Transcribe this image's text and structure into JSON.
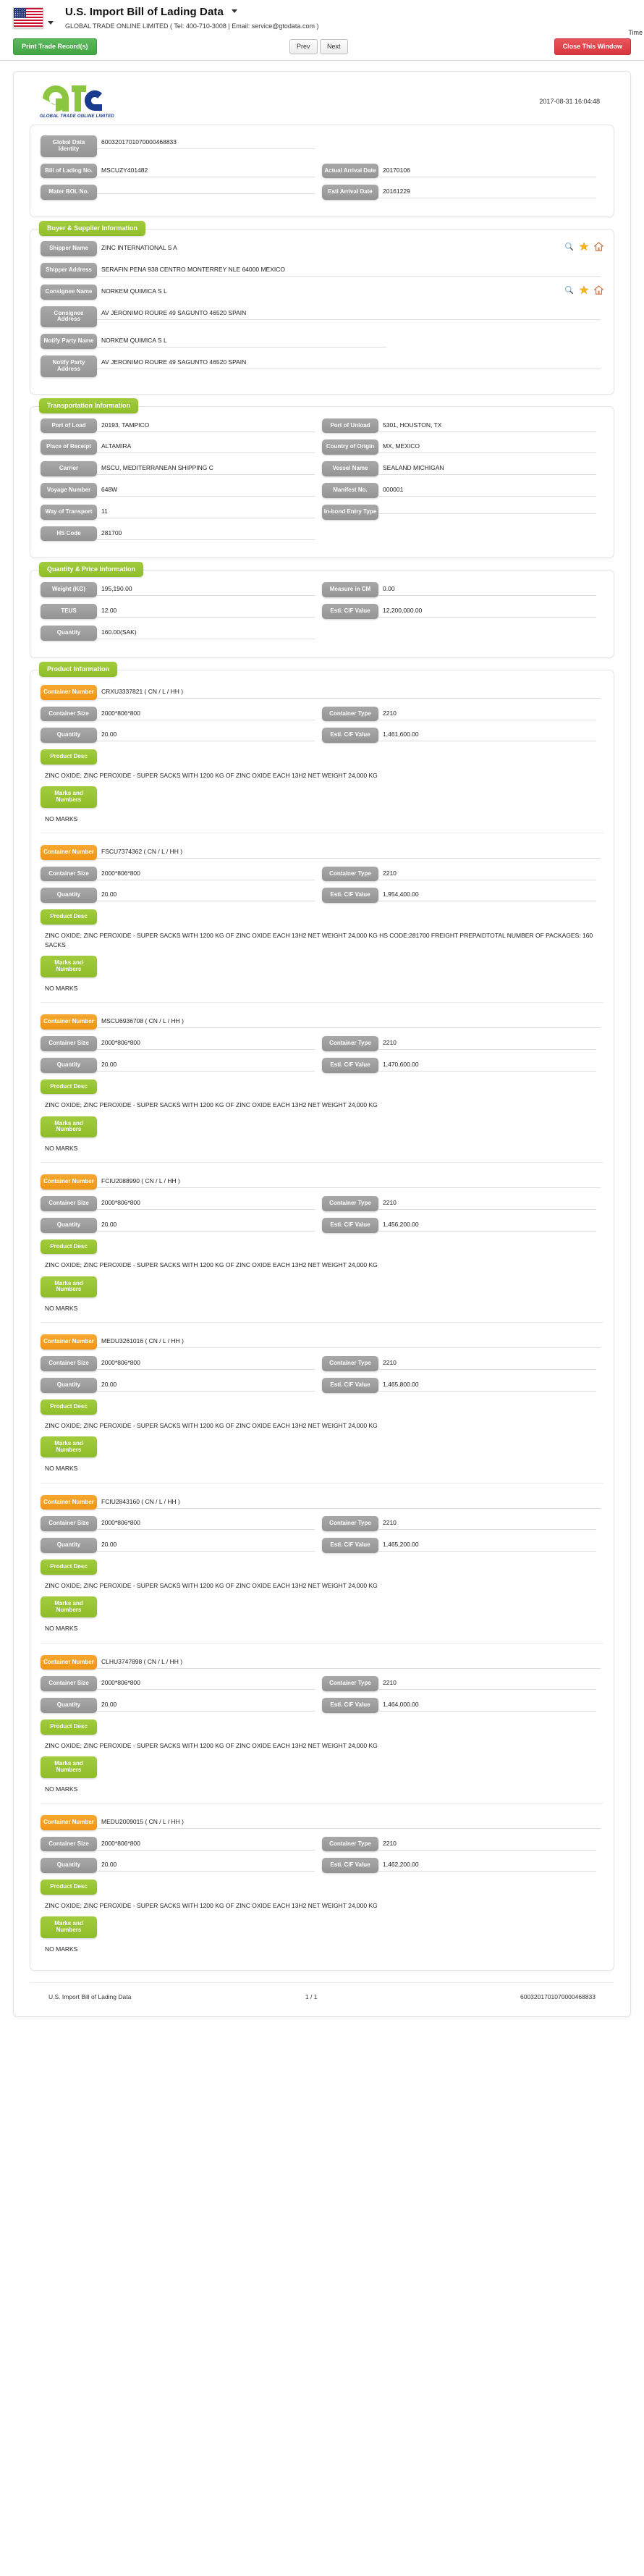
{
  "header": {
    "flag_icon": "us-flag-icon",
    "title": "U.S. Import Bill of Lading Data",
    "subtitle": "GLOBAL TRADE ONLINE LIMITED ( Tel: 400-710-3008  |  Email: service@gtodata.com )",
    "time_label": "Time"
  },
  "toolbar": {
    "print_label": "Print Trade Record(s)",
    "prev_label": "Prev",
    "next_label": "Next",
    "close_label": "Close This Window"
  },
  "document": {
    "logo_caption": "GLOBAL TRADE  ONLINE LIMITED",
    "timestamp": "2017-08-31 16:04:48"
  },
  "identity": {
    "fields": [
      {
        "label": "Global Data Identity",
        "value": "6003201701070000468833"
      },
      {
        "label": "Bill of Lading No.",
        "value": "MSCUZY401482"
      },
      {
        "label": "Actual Arrival Date",
        "value": "20170106"
      },
      {
        "label": "Mater BOL No.",
        "value": ""
      },
      {
        "label": "Esti Arrival Date",
        "value": "20161229"
      }
    ]
  },
  "buyer_supplier": {
    "legend": "Buyer & Supplier Information",
    "fields": [
      {
        "label": "Shipper Name",
        "value": "ZINC INTERNATIONAL S A"
      },
      {
        "label": "Shipper Address",
        "value": "SERAFIN PENA 938 CENTRO MONTERREY NLE 64000 MEXICO"
      },
      {
        "label": "Consignee Name",
        "value": "NORKEM QUIMICA S L"
      },
      {
        "label": "Consignee Address",
        "value": "AV JERONIMO ROURE 49 SAGUNTO 46520 SPAIN"
      },
      {
        "label": "Notify Party Name",
        "value": "NORKEM QUIMICA S L"
      },
      {
        "label": "Notify Party Address",
        "value": "AV JERONIMO ROURE 49 SAGUNTO 46520 SPAIN"
      }
    ],
    "row_icons": [
      "search-icon",
      "star-icon",
      "home-icon"
    ]
  },
  "transportation": {
    "legend": "Transportation Information",
    "fields": [
      {
        "label": "Port of Load",
        "value": "20193, TAMPICO"
      },
      {
        "label": "Port of Unload",
        "value": "5301, HOUSTON, TX"
      },
      {
        "label": "Place of Receipt",
        "value": "ALTAMIRA"
      },
      {
        "label": "Country of Origin",
        "value": "MX, MEXICO"
      },
      {
        "label": "Carrier",
        "value": "MSCU, MEDITERRANEAN SHIPPING C"
      },
      {
        "label": "Vessel Name",
        "value": "SEALAND MICHIGAN"
      },
      {
        "label": "Voyage Number",
        "value": "648W"
      },
      {
        "label": "Manifest No.",
        "value": "000001"
      },
      {
        "label": "Way of Transport",
        "value": "11"
      },
      {
        "label": "In-bond Entry Type",
        "value": ""
      },
      {
        "label": "HS Code",
        "value": "281700"
      }
    ]
  },
  "quantity_price": {
    "legend": "Quantity & Price Information",
    "fields": [
      {
        "label": "Weight (KG)",
        "value": "195,190.00"
      },
      {
        "label": "Measure in CM",
        "value": "0.00"
      },
      {
        "label": "TEUS",
        "value": "12.00"
      },
      {
        "label": "Esti. CIF Value",
        "value": "12,200,000.00"
      },
      {
        "label": "Quantity",
        "value": "160.00(SAK)"
      }
    ]
  },
  "product_information": {
    "legend": "Product Information",
    "labels": {
      "container_number": "Container Number",
      "container_size": "Container Size",
      "container_type": "Container Type",
      "quantity": "Quantity",
      "cif_value": "Esti. CIF Value",
      "product_desc": "Product Desc",
      "marks_and_numbers": "Marks and Numbers"
    },
    "containers": [
      {
        "number": "CRXU3337821 ( CN / L / HH )",
        "size": "2000*806*800",
        "type": "2210",
        "quantity": "20.00",
        "cif_value": "1,461,600.00",
        "description": "ZINC OXIDE; ZINC PEROXIDE - SUPER SACKS WITH 1200 KG OF ZINC OXIDE EACH 13H2 NET WEIGHT 24,000 KG",
        "marks": "NO MARKS"
      },
      {
        "number": "FSCU7374362 ( CN / L / HH )",
        "size": "2000*806*800",
        "type": "2210",
        "quantity": "20.00",
        "cif_value": "1,954,400.00",
        "description": "ZINC OXIDE; ZINC PEROXIDE - SUPER SACKS WITH 1200 KG OF ZINC OXIDE EACH 13H2 NET WEIGHT 24,000 KG HS CODE:281700 FREIGHT PREPAIDTOTAL NUMBER OF PACKAGES: 160 SACKS",
        "marks": "NO MARKS"
      },
      {
        "number": "MSCU6936708 ( CN / L / HH )",
        "size": "2000*806*800",
        "type": "2210",
        "quantity": "20.00",
        "cif_value": "1,470,600.00",
        "description": "ZINC OXIDE; ZINC PEROXIDE - SUPER SACKS WITH 1200 KG OF ZINC OXIDE EACH 13H2 NET WEIGHT 24,000 KG",
        "marks": "NO MARKS"
      },
      {
        "number": "FCIU2088990 ( CN / L / HH )",
        "size": "2000*806*800",
        "type": "2210",
        "quantity": "20.00",
        "cif_value": "1,456,200.00",
        "description": "ZINC OXIDE; ZINC PEROXIDE - SUPER SACKS WITH 1200 KG OF ZINC OXIDE EACH 13H2 NET WEIGHT 24,000 KG",
        "marks": "NO MARKS"
      },
      {
        "number": "MEDU3261016 ( CN / L / HH )",
        "size": "2000*806*800",
        "type": "2210",
        "quantity": "20.00",
        "cif_value": "1,465,800.00",
        "description": "ZINC OXIDE; ZINC PEROXIDE - SUPER SACKS WITH 1200 KG OF ZINC OXIDE EACH 13H2 NET WEIGHT 24,000 KG",
        "marks": "NO MARKS"
      },
      {
        "number": "FCIU2843160 ( CN / L / HH )",
        "size": "2000*806*800",
        "type": "2210",
        "quantity": "20.00",
        "cif_value": "1,465,200.00",
        "description": "ZINC OXIDE; ZINC PEROXIDE - SUPER SACKS WITH 1200 KG OF ZINC OXIDE EACH 13H2 NET WEIGHT 24,000 KG",
        "marks": "NO MARKS"
      },
      {
        "number": "CLHU3747898 ( CN / L / HH )",
        "size": "2000*806*800",
        "type": "2210",
        "quantity": "20.00",
        "cif_value": "1,464,000.00",
        "description": "ZINC OXIDE; ZINC PEROXIDE - SUPER SACKS WITH 1200 KG OF ZINC OXIDE EACH 13H2 NET WEIGHT 24,000 KG",
        "marks": "NO MARKS"
      },
      {
        "number": "MEDU2009015 ( CN / L / HH )",
        "size": "2000*806*800",
        "type": "2210",
        "quantity": "20.00",
        "cif_value": "1,462,200.00",
        "description": "ZINC OXIDE; ZINC PEROXIDE - SUPER SACKS WITH 1200 KG OF ZINC OXIDE EACH 13H2 NET WEIGHT 24,000 KG",
        "marks": "NO MARKS"
      }
    ]
  },
  "footer": {
    "left": "U.S. Import Bill of Lading Data",
    "page": "1 / 1",
    "right": "6003201701070000468833"
  },
  "colors": {
    "green": "#8fbd29",
    "orange": "#f09513",
    "grey": "#949494",
    "print_green": "#44a544",
    "close_red": "#d9363d"
  }
}
